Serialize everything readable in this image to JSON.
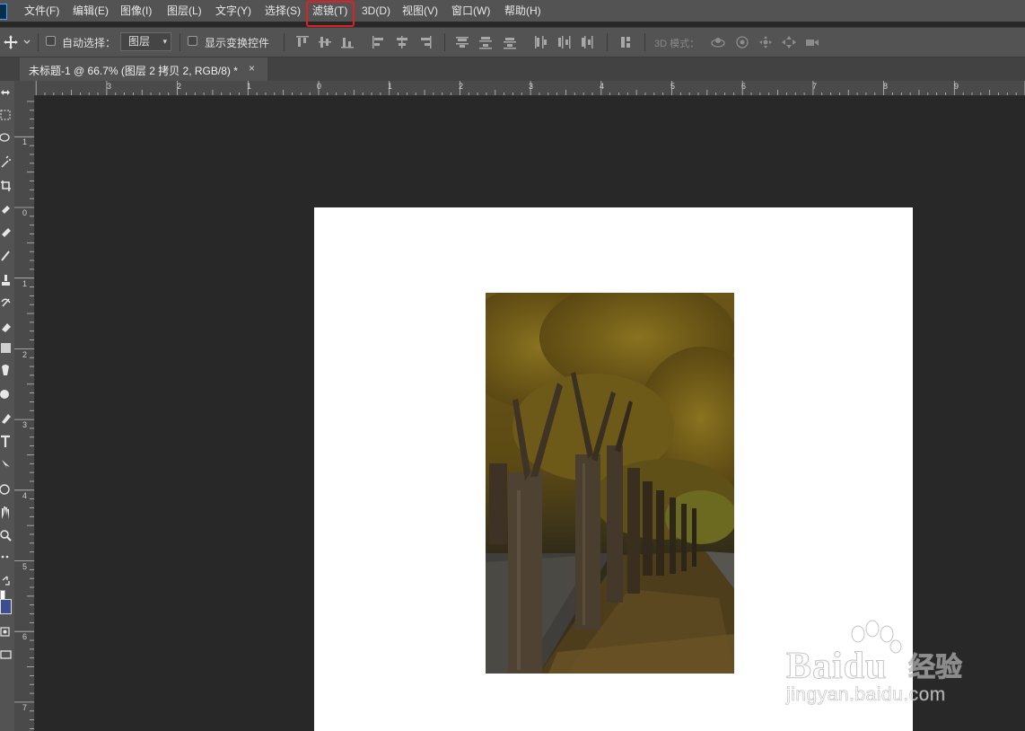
{
  "menubar": {
    "items": [
      {
        "label": "文件(F)"
      },
      {
        "label": "编辑(E)"
      },
      {
        "label": "图像(I)"
      },
      {
        "label": "图层(L)"
      },
      {
        "label": "文字(Y)"
      },
      {
        "label": "选择(S)"
      },
      {
        "label": "滤镜(T)"
      },
      {
        "label": "3D(D)"
      },
      {
        "label": "视图(V)"
      },
      {
        "label": "窗口(W)"
      },
      {
        "label": "帮助(H)"
      }
    ],
    "highlighted_item": "滤镜(T)",
    "highlight_color": "#e02020"
  },
  "options_bar": {
    "auto_select_label": "自动选择：",
    "auto_select_checked": false,
    "layer_select_value": "图层",
    "show_transform_label": "显示变换控件",
    "show_transform_checked": false,
    "mode_3d_label": "3D 模式："
  },
  "document_tab": {
    "title": "未标题-1 @ 66.7% (图层 2 拷贝 2, RGB/8) *",
    "close_glyph": "×"
  },
  "rulers": {
    "top_labels": [
      "3",
      "2",
      "1",
      "0",
      "1",
      "2",
      "3",
      "4",
      "5",
      "6",
      "7",
      "8",
      "9"
    ],
    "left_labels": [
      "1",
      "0",
      "1",
      "2",
      "3",
      "4",
      "5",
      "6",
      "7"
    ]
  },
  "colors": {
    "foreground": "#3d4d8e",
    "background": "#ffffff",
    "workspace": "#282828",
    "panel": "#535353"
  },
  "watermark": {
    "brand": "Baidu",
    "cn": "经验",
    "url": "jingyan.baidu.com"
  }
}
